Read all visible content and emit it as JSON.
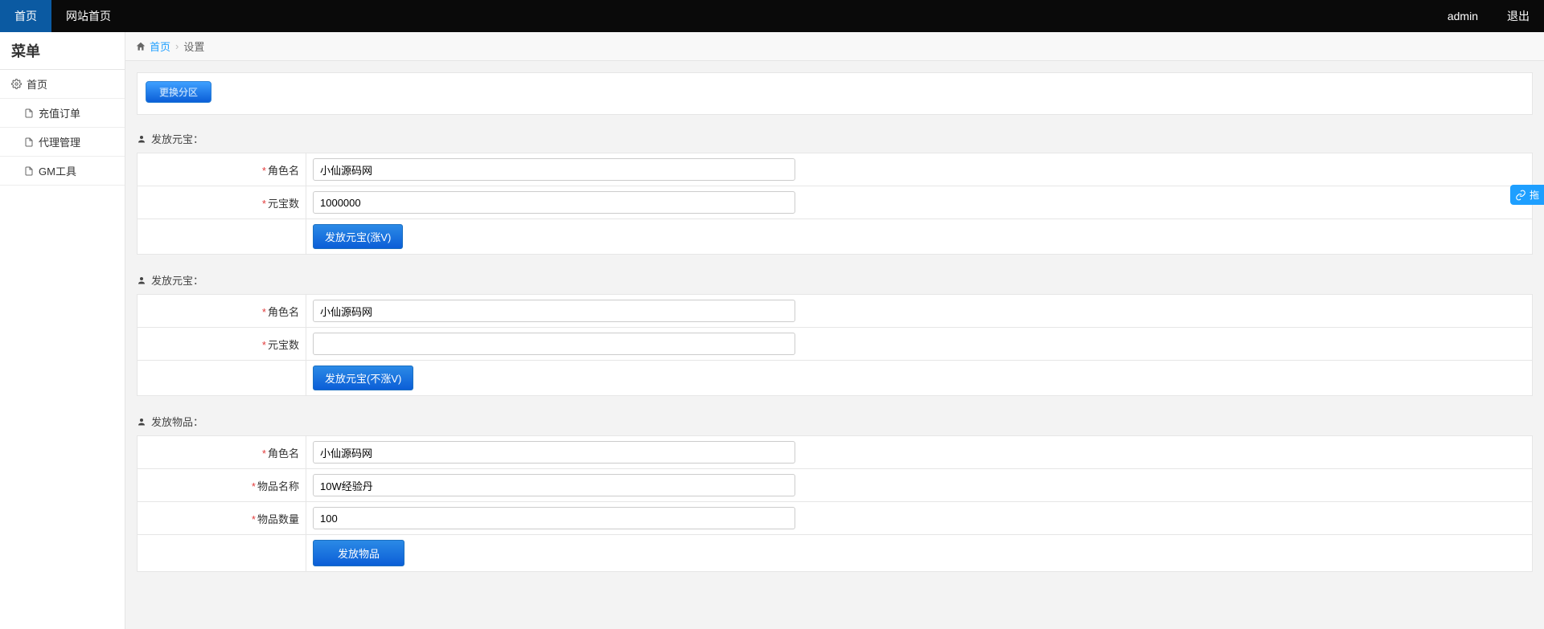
{
  "topnav": {
    "items": [
      {
        "label": "首页",
        "active": true
      },
      {
        "label": "网站首页",
        "active": false
      }
    ],
    "user": "admin",
    "logout": "退出"
  },
  "sidebar": {
    "title": "菜单",
    "items": [
      {
        "label": "首页",
        "icon": "gear"
      },
      {
        "label": "充值订单",
        "icon": "doc"
      },
      {
        "label": "代理管理",
        "icon": "doc"
      },
      {
        "label": "GM工具",
        "icon": "doc"
      }
    ]
  },
  "breadcrumb": {
    "home": "首页",
    "current": "设置"
  },
  "panel1": {
    "change_zone": "更换分区"
  },
  "section1": {
    "title": "发放元宝：",
    "fields": {
      "role_label": "角色名",
      "role_value": "小仙源码网",
      "amount_label": "元宝数",
      "amount_value": "1000000"
    },
    "submit": "发放元宝(涨V)"
  },
  "section2": {
    "title": "发放元宝：",
    "fields": {
      "role_label": "角色名",
      "role_value": "小仙源码网",
      "amount_label": "元宝数",
      "amount_value": ""
    },
    "submit": "发放元宝(不涨V)"
  },
  "section3": {
    "title": "发放物品：",
    "fields": {
      "role_label": "角色名",
      "role_value": "小仙源码网",
      "item_name_label": "物品名称",
      "item_name_value": "10W经验丹",
      "item_count_label": "物品数量",
      "item_count_value": "100"
    },
    "submit": "发放物品"
  },
  "floating": {
    "label": "拖"
  }
}
